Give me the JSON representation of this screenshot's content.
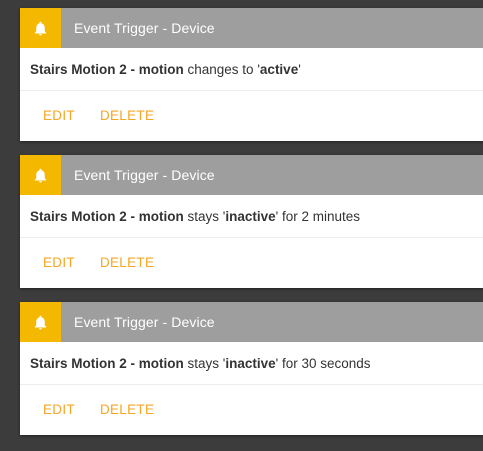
{
  "colors": {
    "background": "#3c3c3c",
    "header": "#9e9e9e",
    "icon_bg": "#f5b800",
    "action_text": "#f5a623"
  },
  "cards": [
    {
      "icon": "bell-icon",
      "title": "Event Trigger - Device",
      "device": "Stairs Motion 2 - motion",
      "verb": "changes to",
      "quote_open": "'",
      "state": "active",
      "quote_close": "'",
      "duration": "",
      "edit_label": "EDIT",
      "delete_label": "DELETE"
    },
    {
      "icon": "bell-icon",
      "title": "Event Trigger - Device",
      "device": "Stairs Motion 2 - motion",
      "verb": "stays",
      "quote_open": "'",
      "state": "inactive",
      "quote_close": "'",
      "duration": "for 2 minutes",
      "edit_label": "EDIT",
      "delete_label": "DELETE"
    },
    {
      "icon": "bell-icon",
      "title": "Event Trigger - Device",
      "device": "Stairs Motion 2 - motion",
      "verb": "stays",
      "quote_open": "'",
      "state": "inactive",
      "quote_close": "'",
      "duration": "for 30 seconds",
      "edit_label": "EDIT",
      "delete_label": "DELETE"
    }
  ]
}
